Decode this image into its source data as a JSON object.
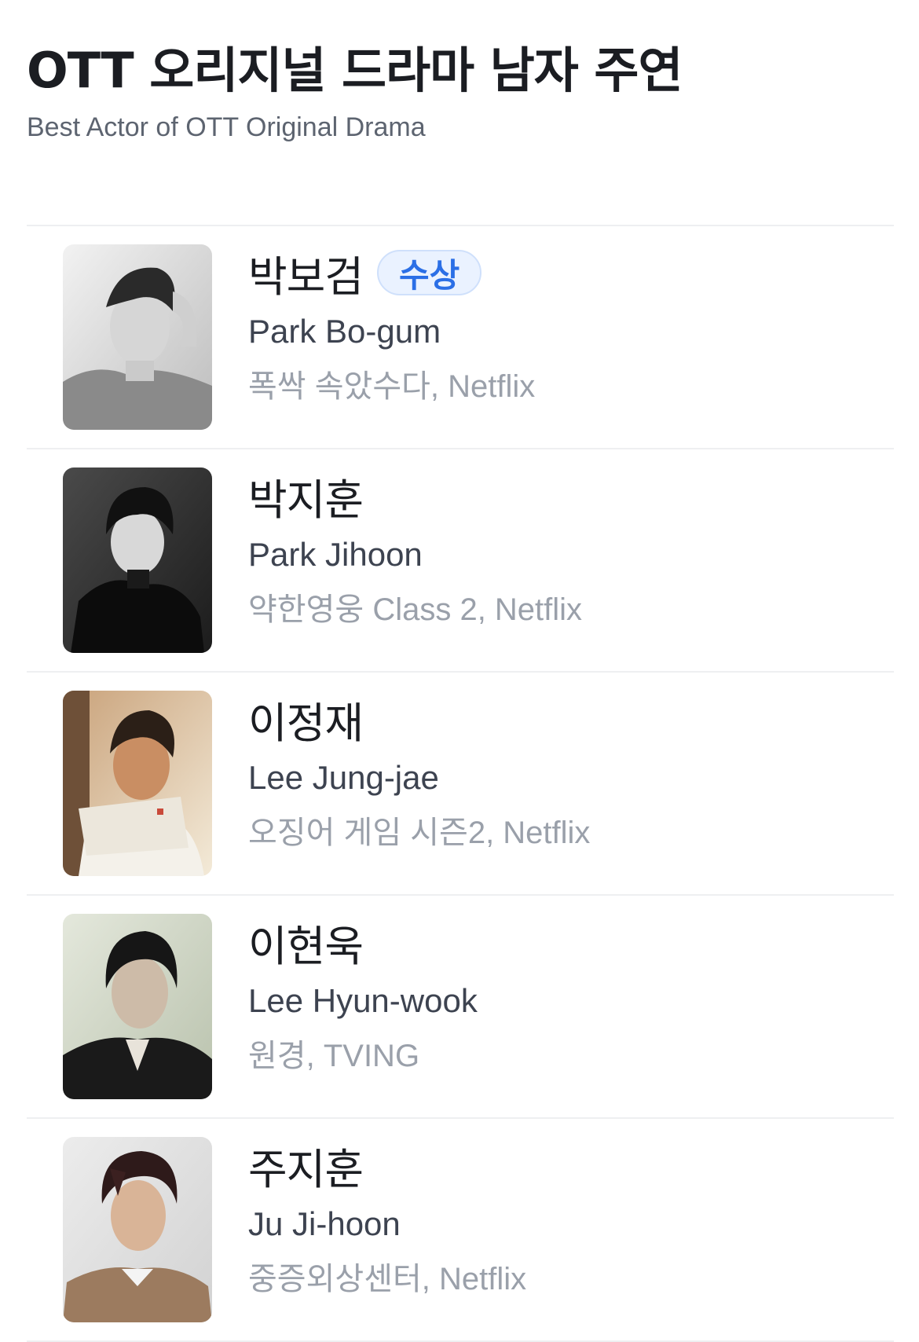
{
  "header": {
    "title": "OTT 오리지널 드라마 남자 주연",
    "subtitle": "Best Actor of OTT Original Drama"
  },
  "nominees": [
    {
      "name_ko": "박보검",
      "name_en": "Park Bo-gum",
      "work": "폭싹 속았수다, Netflix",
      "badge": "수상",
      "photo_icon": "actor-photo"
    },
    {
      "name_ko": "박지훈",
      "name_en": "Park Jihoon",
      "work": "약한영웅 Class 2, Netflix",
      "badge": "",
      "photo_icon": "actor-photo"
    },
    {
      "name_ko": "이정재",
      "name_en": "Lee Jung-jae",
      "work": "오징어 게임 시즌2, Netflix",
      "badge": "",
      "photo_icon": "actor-photo"
    },
    {
      "name_ko": "이현욱",
      "name_en": "Lee Hyun-wook",
      "work": "원경, TVING",
      "badge": "",
      "photo_icon": "actor-photo"
    },
    {
      "name_ko": "주지훈",
      "name_en": "Ju Ji-hoon",
      "work": "중증외상센터, Netflix",
      "badge": "",
      "photo_icon": "actor-photo"
    }
  ],
  "colors": {
    "badge_text": "#2b6fe6",
    "badge_bg": "#eaf2ff",
    "divider": "#eeeff1",
    "muted_text": "#9aa0aa"
  }
}
